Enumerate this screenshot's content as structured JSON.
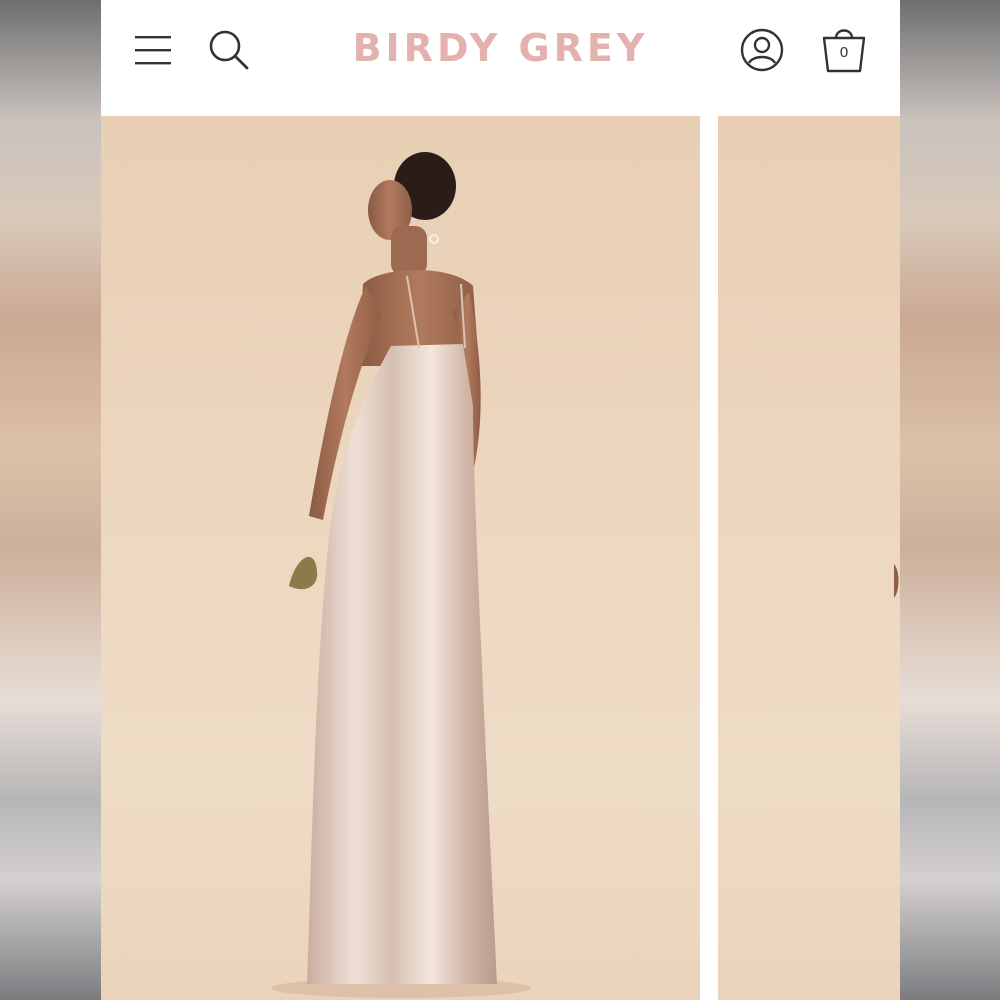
{
  "header": {
    "brand": "BIRDY GREY",
    "brand_color": "#e3b1ae",
    "icons": {
      "menu": "hamburger-menu-icon",
      "search": "search-icon",
      "account": "account-icon",
      "bag": "shopping-bag-icon"
    },
    "bag_count": "0"
  },
  "gallery": {
    "slides": [
      {
        "image": "model-back-view-satin-slip-dress",
        "state": "current"
      },
      {
        "image": "model-partial-view",
        "state": "next-peek"
      }
    ]
  }
}
